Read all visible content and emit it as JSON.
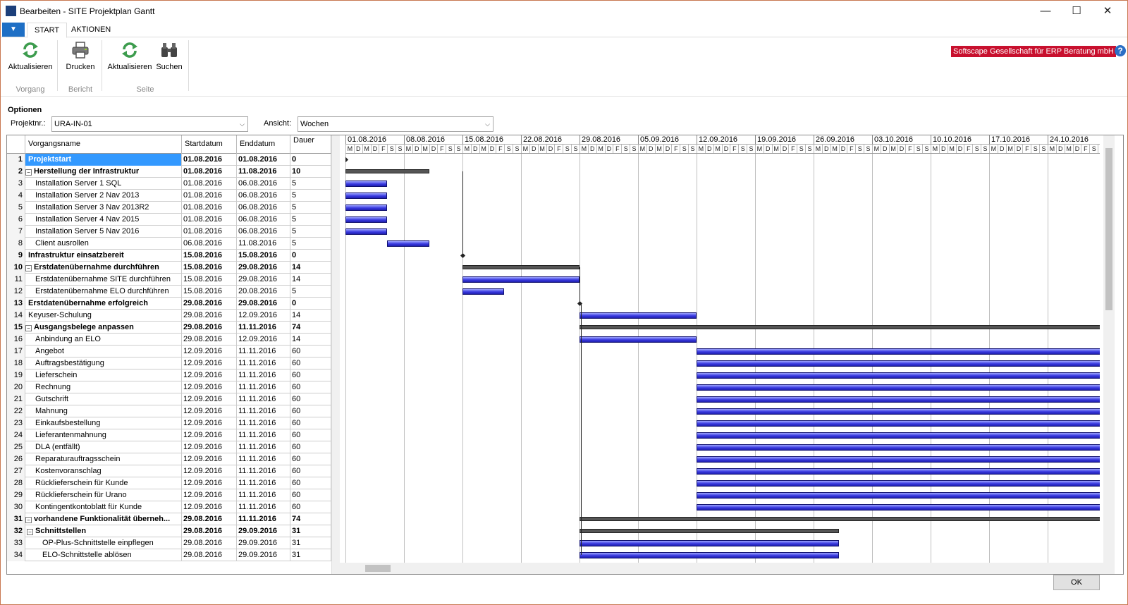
{
  "window": {
    "title": "Bearbeiten - SITE Projektplan Gantt",
    "company": "Softscape Gesellschaft für ERP Beratung mbH",
    "help": "?"
  },
  "tabs": [
    {
      "label": "START"
    },
    {
      "label": "AKTIONEN"
    }
  ],
  "ribbon": {
    "vorgang": {
      "refresh": "Aktualisieren",
      "group": "Vorgang"
    },
    "bericht": {
      "print": "Drucken",
      "group": "Bericht"
    },
    "seite": {
      "refresh": "Aktualisieren",
      "search": "Suchen",
      "group": "Seite"
    }
  },
  "options": {
    "title": "Optionen",
    "projekt_label": "Projektnr.:",
    "projekt_value": "URA-IN-01",
    "ansicht_label": "Ansicht:",
    "ansicht_value": "Wochen"
  },
  "table": {
    "headers": {
      "name": "Vorgangsname",
      "start": "Startdatum",
      "end": "Enddatum",
      "dur": "Dauer"
    },
    "rows": [
      {
        "n": "1",
        "name": "Projektstart",
        "start": "01.08.2016",
        "end": "01.08.2016",
        "dur": "0",
        "summary": true,
        "level": 0,
        "expand": false,
        "selected": true
      },
      {
        "n": "2",
        "name": "Herstellung der Infrastruktur",
        "start": "01.08.2016",
        "end": "11.08.2016",
        "dur": "10",
        "summary": true,
        "level": 0,
        "expand": true
      },
      {
        "n": "3",
        "name": "Installation Server 1 SQL",
        "start": "01.08.2016",
        "end": "06.08.2016",
        "dur": "5",
        "level": 1
      },
      {
        "n": "4",
        "name": "Installation Server 2 Nav 2013",
        "start": "01.08.2016",
        "end": "06.08.2016",
        "dur": "5",
        "level": 1
      },
      {
        "n": "5",
        "name": "Installation Server 3 Nav 2013R2",
        "start": "01.08.2016",
        "end": "06.08.2016",
        "dur": "5",
        "level": 1
      },
      {
        "n": "6",
        "name": "Installation Server 4 Nav 2015",
        "start": "01.08.2016",
        "end": "06.08.2016",
        "dur": "5",
        "level": 1
      },
      {
        "n": "7",
        "name": "Installation Server 5 Nav 2016",
        "start": "01.08.2016",
        "end": "06.08.2016",
        "dur": "5",
        "level": 1
      },
      {
        "n": "8",
        "name": "Client ausrollen",
        "start": "06.08.2016",
        "end": "11.08.2016",
        "dur": "5",
        "level": 1
      },
      {
        "n": "9",
        "name": "Infrastruktur einsatzbereit",
        "start": "15.08.2016",
        "end": "15.08.2016",
        "dur": "0",
        "summary": true,
        "level": 0
      },
      {
        "n": "10",
        "name": "Erstdatenübernahme durchführen",
        "start": "15.08.2016",
        "end": "29.08.2016",
        "dur": "14",
        "summary": true,
        "level": 0,
        "expand": true
      },
      {
        "n": "11",
        "name": "Erstdatenübernahme SITE durchführen",
        "start": "15.08.2016",
        "end": "29.08.2016",
        "dur": "14",
        "level": 1
      },
      {
        "n": "12",
        "name": "Erstdatenübernahme ELO durchführen",
        "start": "15.08.2016",
        "end": "20.08.2016",
        "dur": "5",
        "level": 1
      },
      {
        "n": "13",
        "name": "Erstdatenübernahme erfolgreich",
        "start": "29.08.2016",
        "end": "29.08.2016",
        "dur": "0",
        "summary": true,
        "level": 0
      },
      {
        "n": "14",
        "name": "Keyuser-Schulung",
        "start": "29.08.2016",
        "end": "12.09.2016",
        "dur": "14",
        "level": 0
      },
      {
        "n": "15",
        "name": "Ausgangsbelege anpassen",
        "start": "29.08.2016",
        "end": "11.11.2016",
        "dur": "74",
        "summary": true,
        "level": 0,
        "expand": true
      },
      {
        "n": "16",
        "name": "Anbindung an ELO",
        "start": "29.08.2016",
        "end": "12.09.2016",
        "dur": "14",
        "level": 1
      },
      {
        "n": "17",
        "name": "Angebot",
        "start": "12.09.2016",
        "end": "11.11.2016",
        "dur": "60",
        "level": 1
      },
      {
        "n": "18",
        "name": "Auftragsbestätigung",
        "start": "12.09.2016",
        "end": "11.11.2016",
        "dur": "60",
        "level": 1
      },
      {
        "n": "19",
        "name": "Lieferschein",
        "start": "12.09.2016",
        "end": "11.11.2016",
        "dur": "60",
        "level": 1
      },
      {
        "n": "20",
        "name": "Rechnung",
        "start": "12.09.2016",
        "end": "11.11.2016",
        "dur": "60",
        "level": 1
      },
      {
        "n": "21",
        "name": "Gutschrift",
        "start": "12.09.2016",
        "end": "11.11.2016",
        "dur": "60",
        "level": 1
      },
      {
        "n": "22",
        "name": "Mahnung",
        "start": "12.09.2016",
        "end": "11.11.2016",
        "dur": "60",
        "level": 1
      },
      {
        "n": "23",
        "name": "Einkaufsbestellung",
        "start": "12.09.2016",
        "end": "11.11.2016",
        "dur": "60",
        "level": 1
      },
      {
        "n": "24",
        "name": "Lieferantenmahnung",
        "start": "12.09.2016",
        "end": "11.11.2016",
        "dur": "60",
        "level": 1
      },
      {
        "n": "25",
        "name": "DLA (entfällt)",
        "start": "12.09.2016",
        "end": "11.11.2016",
        "dur": "60",
        "level": 1
      },
      {
        "n": "26",
        "name": "Reparaturauftragsschein",
        "start": "12.09.2016",
        "end": "11.11.2016",
        "dur": "60",
        "level": 1
      },
      {
        "n": "27",
        "name": "Kostenvoranschlag",
        "start": "12.09.2016",
        "end": "11.11.2016",
        "dur": "60",
        "level": 1
      },
      {
        "n": "28",
        "name": "Rücklieferschein für Kunde",
        "start": "12.09.2016",
        "end": "11.11.2016",
        "dur": "60",
        "level": 1
      },
      {
        "n": "29",
        "name": "Rücklieferschein für Urano",
        "start": "12.09.2016",
        "end": "11.11.2016",
        "dur": "60",
        "level": 1
      },
      {
        "n": "30",
        "name": "Kontingentkontoblatt für Kunde",
        "start": "12.09.2016",
        "end": "11.11.2016",
        "dur": "60",
        "level": 1
      },
      {
        "n": "31",
        "name": "vorhandene Funktionalität überneh...",
        "start": "29.08.2016",
        "end": "11.11.2016",
        "dur": "74",
        "summary": true,
        "level": 0,
        "expand": true
      },
      {
        "n": "32",
        "name": "Schnittstellen",
        "start": "29.08.2016",
        "end": "29.09.2016",
        "dur": "31",
        "summary": true,
        "level": 1,
        "expand": true
      },
      {
        "n": "33",
        "name": "OP-Plus-Schnittstelle einpflegen",
        "start": "29.08.2016",
        "end": "29.09.2016",
        "dur": "31",
        "level": 2
      },
      {
        "n": "34",
        "name": "ELO-Schnittstelle ablösen",
        "start": "29.08.2016",
        "end": "29.09.2016",
        "dur": "31",
        "level": 2
      }
    ]
  },
  "gantt": {
    "weeks": [
      "01.08.2016",
      "08.08.2016",
      "15.08.2016",
      "22.08.2016",
      "29.08.2016",
      "05.09.2016",
      "12.09.2016",
      "19.09.2016",
      "26.09.2016",
      "03.10.2016",
      "10.10.2016",
      "17.10.2016",
      "24.10.2016"
    ],
    "day_letters": [
      "M",
      "D",
      "M",
      "D",
      "F",
      "S",
      "S"
    ]
  },
  "footer": {
    "ok": "OK"
  }
}
